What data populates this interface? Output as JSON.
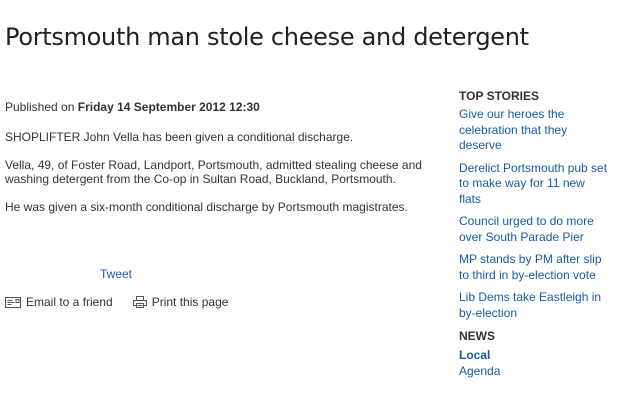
{
  "article": {
    "headline": "Portsmouth man stole cheese and detergent",
    "published_prefix": "Published on ",
    "published_date": "Friday 14 September 2012 12:30",
    "paragraphs": [
      "SHOPLIFTER John Vella has been given a conditional discharge.",
      "Vella, 49, of Foster Road, Landport, Portsmouth, admitted stealing cheese and washing detergent from the Co-op in Sultan Road, Buckland, Portsmouth.",
      "He was given a six-month conditional discharge by Portsmouth magistrates."
    ]
  },
  "share": {
    "tweet_label": "Tweet",
    "email_label": "Email to a friend",
    "email_icon": "envelope-icon",
    "print_label": "Print this page",
    "print_icon": "printer-icon"
  },
  "sidebar": {
    "top_stories_heading": "TOP STORIES",
    "top_stories": [
      "Give our heroes the celebration that they deserve",
      "Derelict Portsmouth pub set to make way for 11 new flats",
      "Council urged to do more over South Parade Pier",
      "MP stands by PM after slip to third in by-election vote",
      "Lib Dems take Eastleigh in by-election"
    ],
    "news_heading": "NEWS",
    "news_links": [
      "Local",
      "Agenda"
    ]
  },
  "colors": {
    "link": "#1a5aa5",
    "text": "#333333",
    "headline": "#222222"
  }
}
